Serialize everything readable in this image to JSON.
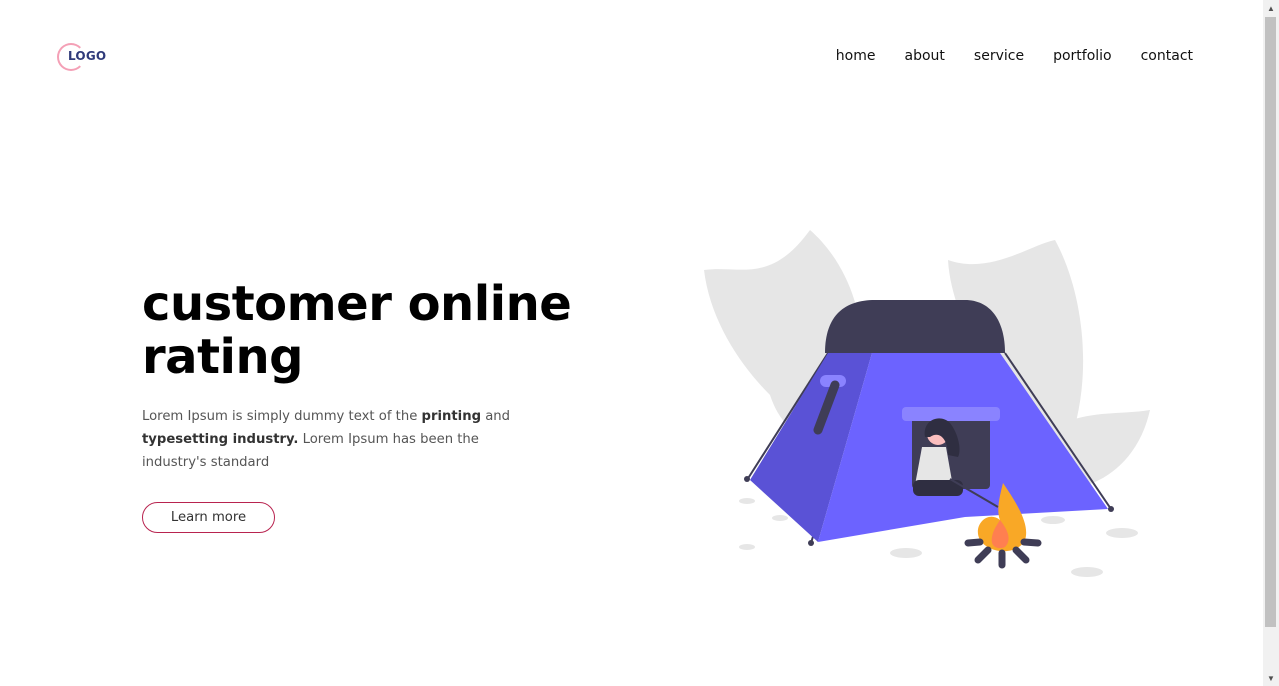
{
  "header": {
    "logo_text": "LOGO",
    "nav": [
      "home",
      "about",
      "service",
      "portfolio",
      "contact"
    ]
  },
  "hero": {
    "title": "customer online rating",
    "desc_1": "Lorem Ipsum is simply dummy text of the ",
    "desc_bold_1": "printing",
    "desc_2": " and ",
    "desc_bold_2": "typesetting industry.",
    "desc_3": " Lorem Ipsum has been the industry's standard",
    "button_label": "Learn more"
  },
  "illustration": {
    "name": "camping-tent-campfire",
    "colors": {
      "tent": "#6c63ff",
      "tent_shade": "#5a52d6",
      "tent_top": "#3f3d56",
      "leaves": "#e6e6e6",
      "fire_outer": "#f9a826",
      "fire_inner": "#ff7f50"
    }
  },
  "colors": {
    "button_border": "#b8234f",
    "logo_ring": "#f4a0b6",
    "logo_text": "#2f3a7a"
  }
}
